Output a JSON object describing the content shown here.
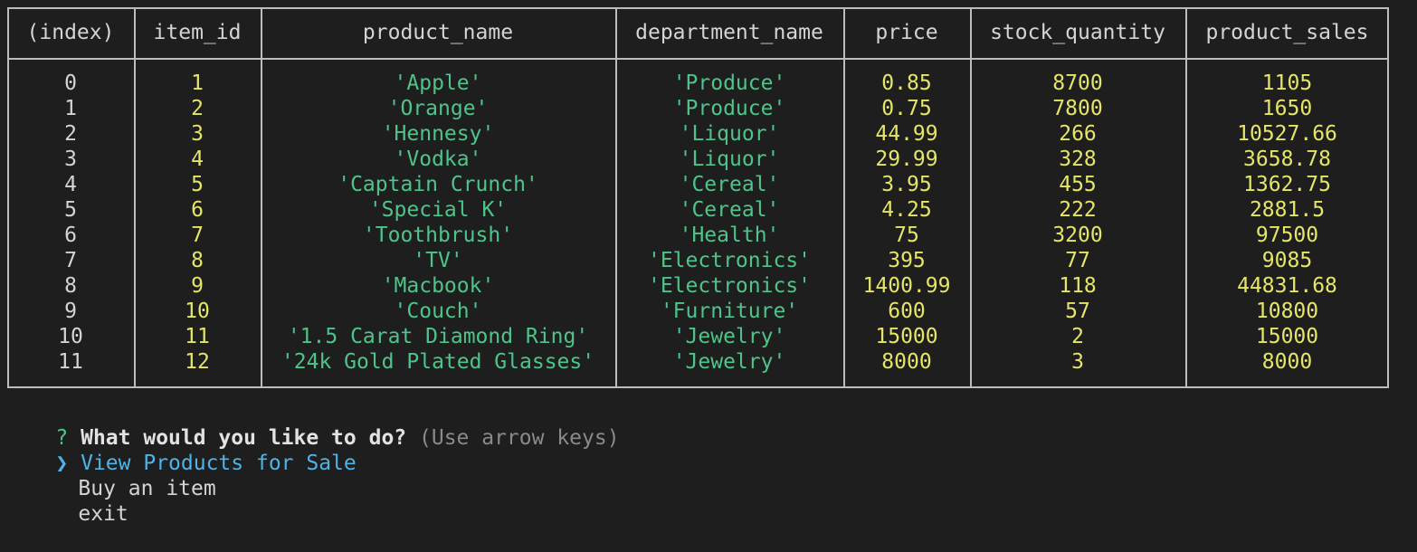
{
  "table": {
    "headers": [
      "(index)",
      "item_id",
      "product_name",
      "department_name",
      "price",
      "stock_quantity",
      "product_sales"
    ],
    "rows": [
      [
        "0",
        "1",
        "'Apple'",
        "'Produce'",
        "0.85",
        "8700",
        "1105"
      ],
      [
        "1",
        "2",
        "'Orange'",
        "'Produce'",
        "0.75",
        "7800",
        "1650"
      ],
      [
        "2",
        "3",
        "'Hennesy'",
        "'Liquor'",
        "44.99",
        "266",
        "10527.66"
      ],
      [
        "3",
        "4",
        "'Vodka'",
        "'Liquor'",
        "29.99",
        "328",
        "3658.78"
      ],
      [
        "4",
        "5",
        "'Captain Crunch'",
        "'Cereal'",
        "3.95",
        "455",
        "1362.75"
      ],
      [
        "5",
        "6",
        "'Special K'",
        "'Cereal'",
        "4.25",
        "222",
        "2881.5"
      ],
      [
        "6",
        "7",
        "'Toothbrush'",
        "'Health'",
        "75",
        "3200",
        "97500"
      ],
      [
        "7",
        "8",
        "'TV'",
        "'Electronics'",
        "395",
        "77",
        "9085"
      ],
      [
        "8",
        "9",
        "'Macbook'",
        "'Electronics'",
        "1400.99",
        "118",
        "44831.68"
      ],
      [
        "9",
        "10",
        "'Couch'",
        "'Furniture'",
        "600",
        "57",
        "10800"
      ],
      [
        "10",
        "11",
        "'1.5 Carat Diamond Ring'",
        "'Jewelry'",
        "15000",
        "2",
        "15000"
      ],
      [
        "11",
        "12",
        "'24k Gold Plated Glasses'",
        "'Jewelry'",
        "8000",
        "3",
        "8000"
      ]
    ]
  },
  "prompt": {
    "marker": "?",
    "question": "What would you like to do?",
    "hint": "(Use arrow keys)",
    "pointer": "❯",
    "options": [
      "View Products for Sale",
      "Buy an item",
      "exit"
    ],
    "selected_index": 0
  },
  "colors": {
    "background": "#1e1e1e",
    "number": "#e5e56a",
    "string": "#4ec48a",
    "selected": "#4fb3e6",
    "border": "#bdbdbd"
  }
}
